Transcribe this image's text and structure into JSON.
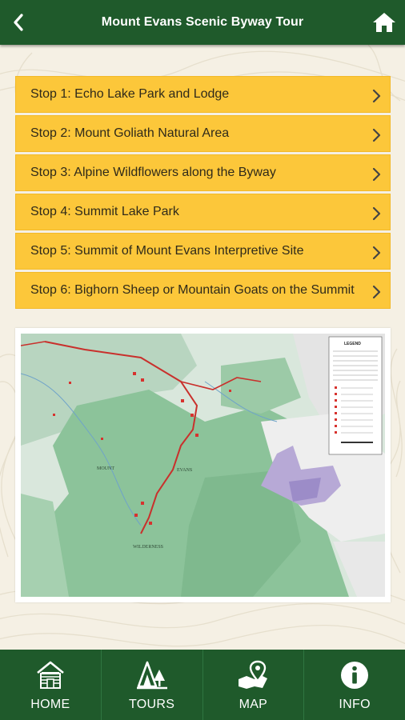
{
  "header": {
    "title": "Mount Evans Scenic Byway Tour",
    "back_icon": "chevron-left-icon",
    "home_icon": "house-icon"
  },
  "stops": [
    {
      "label": "Stop 1: Echo Lake Park and Lodge"
    },
    {
      "label": "Stop 2: Mount Goliath Natural Area"
    },
    {
      "label": "Stop 3: Alpine Wildflowers along the Byway"
    },
    {
      "label": "Stop 4: Summit Lake Park"
    },
    {
      "label": "Stop 5: Summit of Mount Evans Interpretive Site"
    },
    {
      "label": "Stop 6: Bighorn Sheep or Mountain Goats on the Summit"
    }
  ],
  "map": {
    "legend_title": "LEGEND",
    "labels": [
      "MOUNT",
      "EVANS",
      "WILDERNESS"
    ]
  },
  "tabs": [
    {
      "label": "HOME",
      "icon": "cabin-icon"
    },
    {
      "label": "TOURS",
      "icon": "tent-trees-icon"
    },
    {
      "label": "MAP",
      "icon": "map-pin-icon"
    },
    {
      "label": "INFO",
      "icon": "info-circle-icon"
    }
  ],
  "colors": {
    "header_green": "#1f5a2b",
    "stop_yellow": "#fcc73a",
    "background": "#f5f0e4"
  }
}
